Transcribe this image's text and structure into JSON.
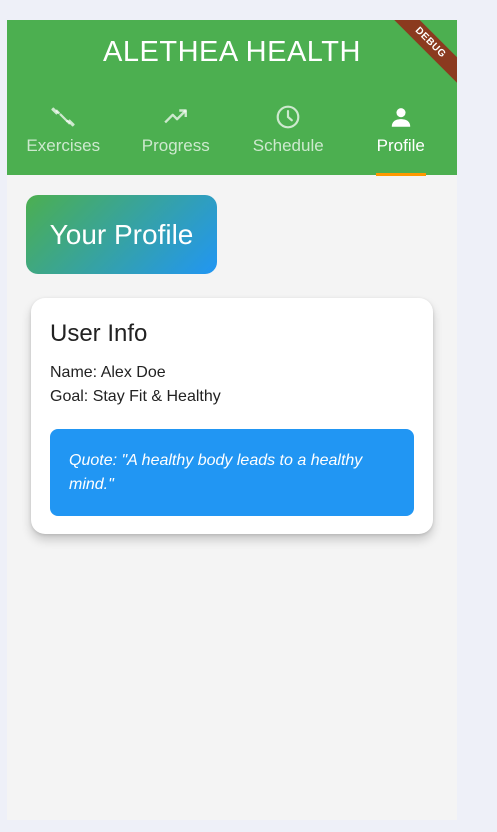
{
  "app": {
    "title": "ALETHEA HEALTH",
    "debug_banner": "DEBUG"
  },
  "tabs": [
    {
      "label": "Exercises",
      "icon": "fitness-icon"
    },
    {
      "label": "Progress",
      "icon": "trending-up-icon"
    },
    {
      "label": "Schedule",
      "icon": "clock-icon"
    },
    {
      "label": "Profile",
      "icon": "person-icon"
    }
  ],
  "active_tab": "Profile",
  "profile": {
    "chip_label": "Your Profile",
    "card_title": "User Info",
    "name_line": "Name: Alex Doe",
    "goal_line": "Goal: Stay Fit & Healthy",
    "quote": "Quote: \"A healthy body leads to a healthy mind.\""
  },
  "colors": {
    "primary_green": "#4caf50",
    "accent_blue": "#2196f3",
    "indicator_orange": "#ff9800",
    "debug_banner": "#8b3a1f"
  }
}
